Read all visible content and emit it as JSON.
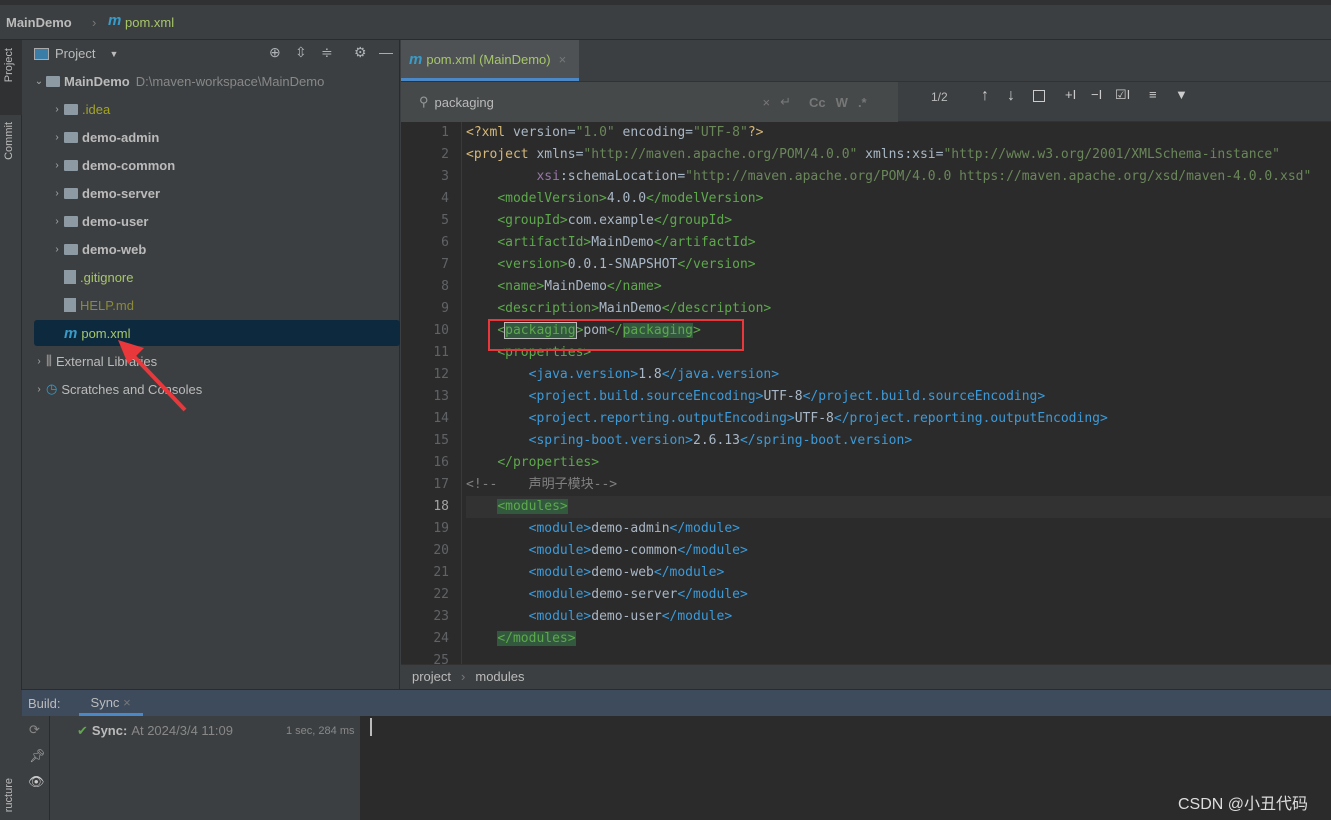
{
  "breadcrumb": {
    "project": "MainDemo",
    "file": "pom.xml"
  },
  "stripe": {
    "project": "Project",
    "commit": "Commit",
    "structure": "ructure"
  },
  "project_panel": {
    "title": "Project",
    "tree": [
      {
        "label": "MainDemo",
        "path": "D:\\maven-workspace\\MainDemo",
        "kind": "module-root"
      },
      {
        "label": ".idea",
        "kind": "folder",
        "color": "#a4a424"
      },
      {
        "label": "demo-admin",
        "kind": "module"
      },
      {
        "label": "demo-common",
        "kind": "module"
      },
      {
        "label": "demo-server",
        "kind": "module"
      },
      {
        "label": "demo-user",
        "kind": "module"
      },
      {
        "label": "demo-web",
        "kind": "module"
      },
      {
        "label": ".gitignore",
        "kind": "file",
        "color": "#a7c66a"
      },
      {
        "label": "HELP.md",
        "kind": "file",
        "color": "#8a8a3a"
      },
      {
        "label": "pom.xml",
        "kind": "maven",
        "color": "#a7c66a",
        "selected": true
      },
      {
        "label": "External Libraries",
        "kind": "libraries"
      },
      {
        "label": "Scratches and Consoles",
        "kind": "scratches"
      }
    ]
  },
  "editor": {
    "tab": "pom.xml (MainDemo)",
    "search": {
      "value": "packaging",
      "count": "1/2",
      "cc": "Cc",
      "w": "W",
      "regex": ".*"
    },
    "current_line": 18,
    "lines": [
      [
        [
          "y",
          "<?xml "
        ],
        [
          "tx",
          "version="
        ],
        [
          "v",
          "\"1.0\""
        ],
        [
          "tx",
          " encoding="
        ],
        [
          "v",
          "\"UTF-8\""
        ],
        [
          "y",
          "?>"
        ]
      ],
      [
        [
          "y",
          "<project "
        ],
        [
          "tx",
          "xmlns="
        ],
        [
          "v",
          "\"http://maven.apache.org/POM/4.0.0\""
        ],
        [
          "tx",
          " xmlns:xsi="
        ],
        [
          "v",
          "\"http://www.w3.org/2001/XMLSchema-instance\""
        ]
      ],
      [
        [
          "tx",
          "         "
        ],
        [
          "ns",
          "xsi"
        ],
        [
          "tx",
          ":schemaLocation="
        ],
        [
          "v",
          "\"http://maven.apache.org/POM/4.0.0 https://maven.apache.org/xsd/maven-4.0.0.xsd\""
        ]
      ],
      [
        [
          "tx",
          "    "
        ],
        [
          "t1",
          "<modelVersion>"
        ],
        [
          "tx",
          "4.0.0"
        ],
        [
          "t1",
          "</modelVersion>"
        ]
      ],
      [
        [
          "tx",
          "    "
        ],
        [
          "t1",
          "<groupId>"
        ],
        [
          "tx",
          "com.example"
        ],
        [
          "t1",
          "</groupId>"
        ]
      ],
      [
        [
          "tx",
          "    "
        ],
        [
          "t1",
          "<artifactId>"
        ],
        [
          "tx",
          "MainDemo"
        ],
        [
          "t1",
          "</artifactId>"
        ]
      ],
      [
        [
          "tx",
          "    "
        ],
        [
          "t1",
          "<version>"
        ],
        [
          "tx",
          "0.0.1-SNAPSHOT"
        ],
        [
          "t1",
          "</version>"
        ]
      ],
      [
        [
          "tx",
          "    "
        ],
        [
          "t1",
          "<name>"
        ],
        [
          "tx",
          "MainDemo"
        ],
        [
          "t1",
          "</name>"
        ]
      ],
      [
        [
          "tx",
          "    "
        ],
        [
          "t1",
          "<description>"
        ],
        [
          "tx",
          "MainDemo"
        ],
        [
          "t1",
          "</description>"
        ]
      ],
      [
        [
          "tx",
          "    "
        ],
        [
          "t1",
          "<"
        ],
        [
          "t1 hlb",
          "packaging"
        ],
        [
          "t1",
          ">"
        ],
        [
          "tx",
          "pom"
        ],
        [
          "t1",
          "</"
        ],
        [
          "t1 hl",
          "packaging"
        ],
        [
          "t1",
          ">"
        ]
      ],
      [
        [
          "tx",
          "    "
        ],
        [
          "t1",
          "<properties>"
        ]
      ],
      [
        [
          "tx",
          "        "
        ],
        [
          "t2",
          "<java.version>"
        ],
        [
          "tx",
          "1.8"
        ],
        [
          "t2",
          "</java.version>"
        ]
      ],
      [
        [
          "tx",
          "        "
        ],
        [
          "t2",
          "<project.build.sourceEncoding>"
        ],
        [
          "tx",
          "UTF-8"
        ],
        [
          "t2",
          "</project.build.sourceEncoding>"
        ]
      ],
      [
        [
          "tx",
          "        "
        ],
        [
          "t2",
          "<project.reporting.outputEncoding>"
        ],
        [
          "tx",
          "UTF-8"
        ],
        [
          "t2",
          "</project.reporting.outputEncoding>"
        ]
      ],
      [
        [
          "tx",
          "        "
        ],
        [
          "t2",
          "<spring-boot.version>"
        ],
        [
          "tx",
          "2.6.13"
        ],
        [
          "t2",
          "</spring-boot.version>"
        ]
      ],
      [
        [
          "tx",
          "    "
        ],
        [
          "t1",
          "</properties>"
        ]
      ],
      [
        [
          "cm",
          "<!--    声明子模块-->"
        ]
      ],
      [
        [
          "tx",
          "    "
        ],
        [
          "t1 hl",
          "<modules>"
        ]
      ],
      [
        [
          "tx",
          "        "
        ],
        [
          "t2",
          "<module>"
        ],
        [
          "tx",
          "demo-admin"
        ],
        [
          "t2",
          "</module>"
        ]
      ],
      [
        [
          "tx",
          "        "
        ],
        [
          "t2",
          "<module>"
        ],
        [
          "tx",
          "demo-common"
        ],
        [
          "t2",
          "</module>"
        ]
      ],
      [
        [
          "tx",
          "        "
        ],
        [
          "t2",
          "<module>"
        ],
        [
          "tx",
          "demo-web"
        ],
        [
          "t2",
          "</module>"
        ]
      ],
      [
        [
          "tx",
          "        "
        ],
        [
          "t2",
          "<module>"
        ],
        [
          "tx",
          "demo-server"
        ],
        [
          "t2",
          "</module>"
        ]
      ],
      [
        [
          "tx",
          "        "
        ],
        [
          "t2",
          "<module>"
        ],
        [
          "tx",
          "demo-user"
        ],
        [
          "t2",
          "</module>"
        ]
      ],
      [
        [
          "tx",
          "    "
        ],
        [
          "t1 hl",
          "</modules>"
        ]
      ],
      []
    ],
    "breadcrumbs": [
      "project",
      "modules"
    ]
  },
  "build": {
    "label": "Build:",
    "tab": "Sync",
    "status": "Sync:",
    "time": "At 2024/3/4 11:09",
    "duration": "1 sec, 284 ms"
  },
  "watermark": "CSDN @小丑代码",
  "colors": {
    "annotation": "#e8383b",
    "selection": "#0d293e",
    "accent": "#4a88c7"
  }
}
